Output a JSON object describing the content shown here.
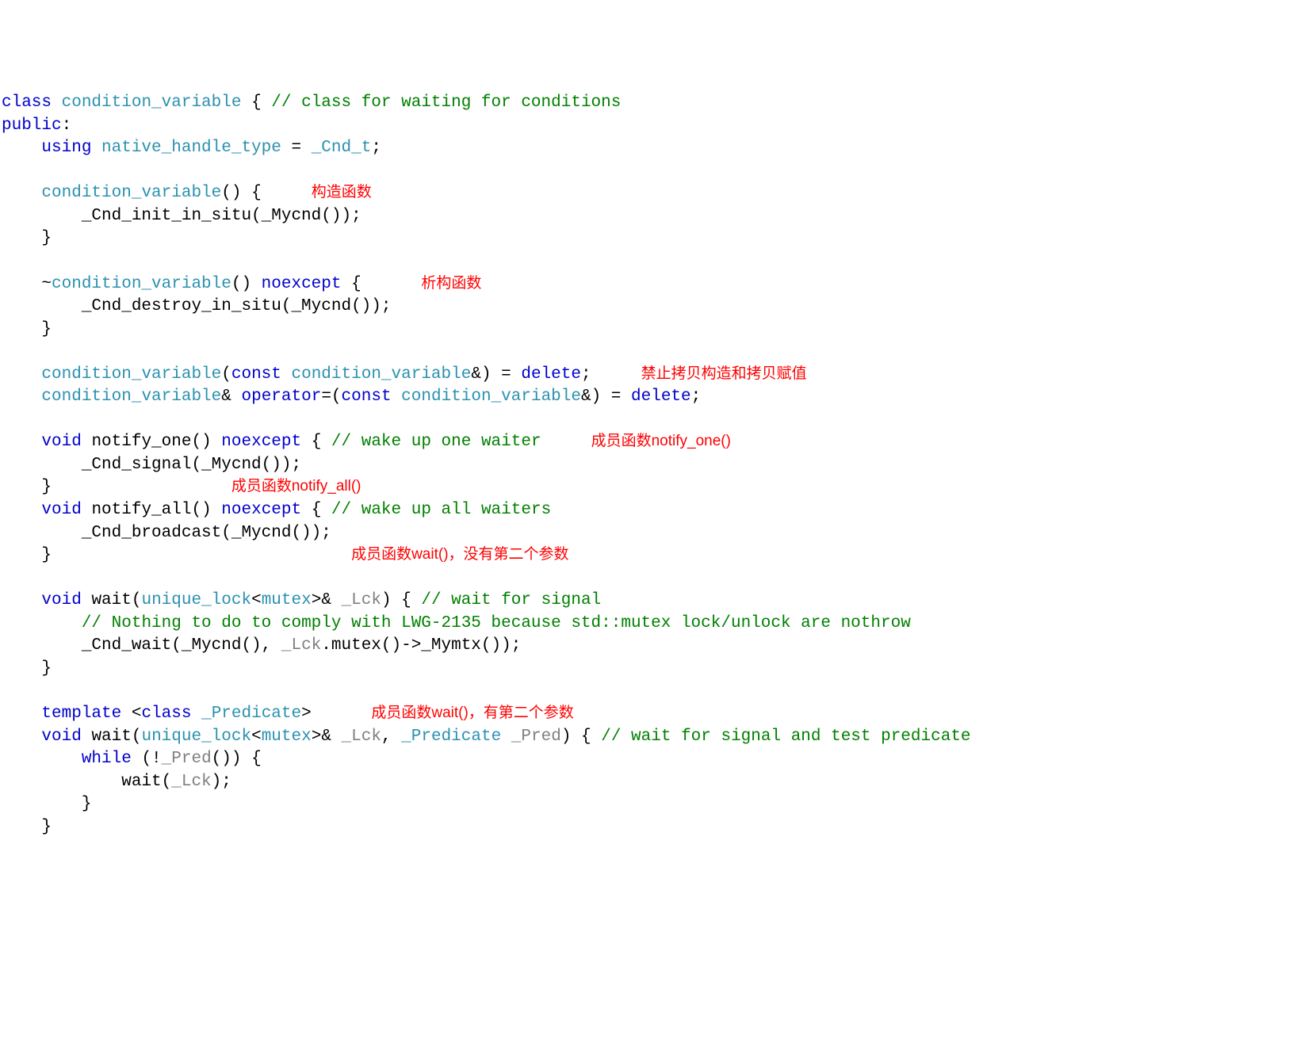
{
  "lines": {
    "l1_class": "class",
    "l1_name": "condition_variable",
    "l1_brace": " { ",
    "l1_comment": "// class for waiting for conditions",
    "l2_public": "public",
    "l2_colon": ":",
    "l3_using": "    using",
    "l3_nht": " native_handle_type",
    "l3_eq": " = ",
    "l3_cndt": "_Cnd_t",
    "l3_semi": ";",
    "l5_indent": "    ",
    "l5_ctor": "condition_variable",
    "l5_after": "() {     ",
    "l5_ann": "构造函数",
    "l6_body": "        _Cnd_init_in_situ(_Mycnd());",
    "l7_close": "    }",
    "l9_indent": "    ~",
    "l9_dtor": "condition_variable",
    "l9_p": "() ",
    "l9_noexcept": "noexcept",
    "l9_b": " {      ",
    "l9_ann": "析构函数",
    "l10_body": "        _Cnd_destroy_in_situ(_Mycnd());",
    "l11_close": "    }",
    "l13_indent": "    ",
    "l13_cv": "condition_variable",
    "l13_p1": "(",
    "l13_const": "const",
    "l13_sp": " ",
    "l13_cv2": "condition_variable",
    "l13_after": "&) = ",
    "l13_del": "delete",
    "l13_semi": ";     ",
    "l13_ann": "禁止拷贝构造和拷贝赋值",
    "l14_indent": "    ",
    "l14_cv": "condition_variable",
    "l14_amp": "& ",
    "l14_op": "operator",
    "l14_eq": "=(",
    "l14_const": "const",
    "l14_sp": " ",
    "l14_cv2": "condition_variable",
    "l14_after": "&) = ",
    "l14_del": "delete",
    "l14_semi": ";",
    "l16_indent": "    ",
    "l16_void": "void",
    "l16_name": " notify_one() ",
    "l16_noexcept": "noexcept",
    "l16_brace": " { ",
    "l16_comment": "// wake up one waiter",
    "l16_pad": "     ",
    "l16_ann": "成员函数notify_one()",
    "l17_body": "        _Cnd_signal(_Mycnd());",
    "l18_close": "    }",
    "l18_pad2": "                  ",
    "l18_ann": "成员函数notify_all()",
    "l19_indent": "    ",
    "l19_void": "void",
    "l19_name": " notify_all() ",
    "l19_noexcept": "noexcept",
    "l19_brace": " { ",
    "l19_comment": "// wake up all waiters",
    "l20_body": "        _Cnd_broadcast(_Mycnd());",
    "l21_close": "    }",
    "l21_pad": "                              ",
    "l21_ann": "成员函数wait()，没有第二个参数",
    "l23_indent": "    ",
    "l23_void": "void",
    "l23_name": " wait(",
    "l23_ul": "unique_lock",
    "l23_lt": "<",
    "l23_mutex": "mutex",
    "l23_gt": ">& ",
    "l23_lck": "_Lck",
    "l23_brace": ") { ",
    "l23_comment": "// wait for signal",
    "l24_indent": "        ",
    "l24_comment": "// Nothing to do to comply with LWG-2135 because std::mutex lock/unlock are nothrow",
    "l25_indent": "        _Cnd_wait(_Mycnd(), ",
    "l25_lck": "_Lck",
    "l25_after": ".mutex()->_Mymtx());",
    "l26_close": "    }",
    "l28_indent": "    ",
    "l28_template": "template",
    "l28_lt": " <",
    "l28_class": "class",
    "l28_sp": " ",
    "l28_pred": "_Predicate",
    "l28_gt": ">      ",
    "l28_ann": "成员函数wait()，有第二个参数",
    "l29_indent": "    ",
    "l29_void": "void",
    "l29_name": " wait(",
    "l29_ul": "unique_lock",
    "l29_lt": "<",
    "l29_mutex": "mutex",
    "l29_gt": ">& ",
    "l29_lck": "_Lck",
    "l29_comma": ", ",
    "l29_predt": "_Predicate",
    "l29_sp": " ",
    "l29_pred": "_Pred",
    "l29_brace": ") { ",
    "l29_comment": "// wait for signal and test predicate",
    "l30_indent": "        ",
    "l30_while": "while",
    "l30_cond": " (!",
    "l30_pred": "_Pred",
    "l30_after": "()) {",
    "l31_indent": "            wait(",
    "l31_lck": "_Lck",
    "l31_after": ");",
    "l32_close": "        }",
    "l33_close": "    }"
  }
}
